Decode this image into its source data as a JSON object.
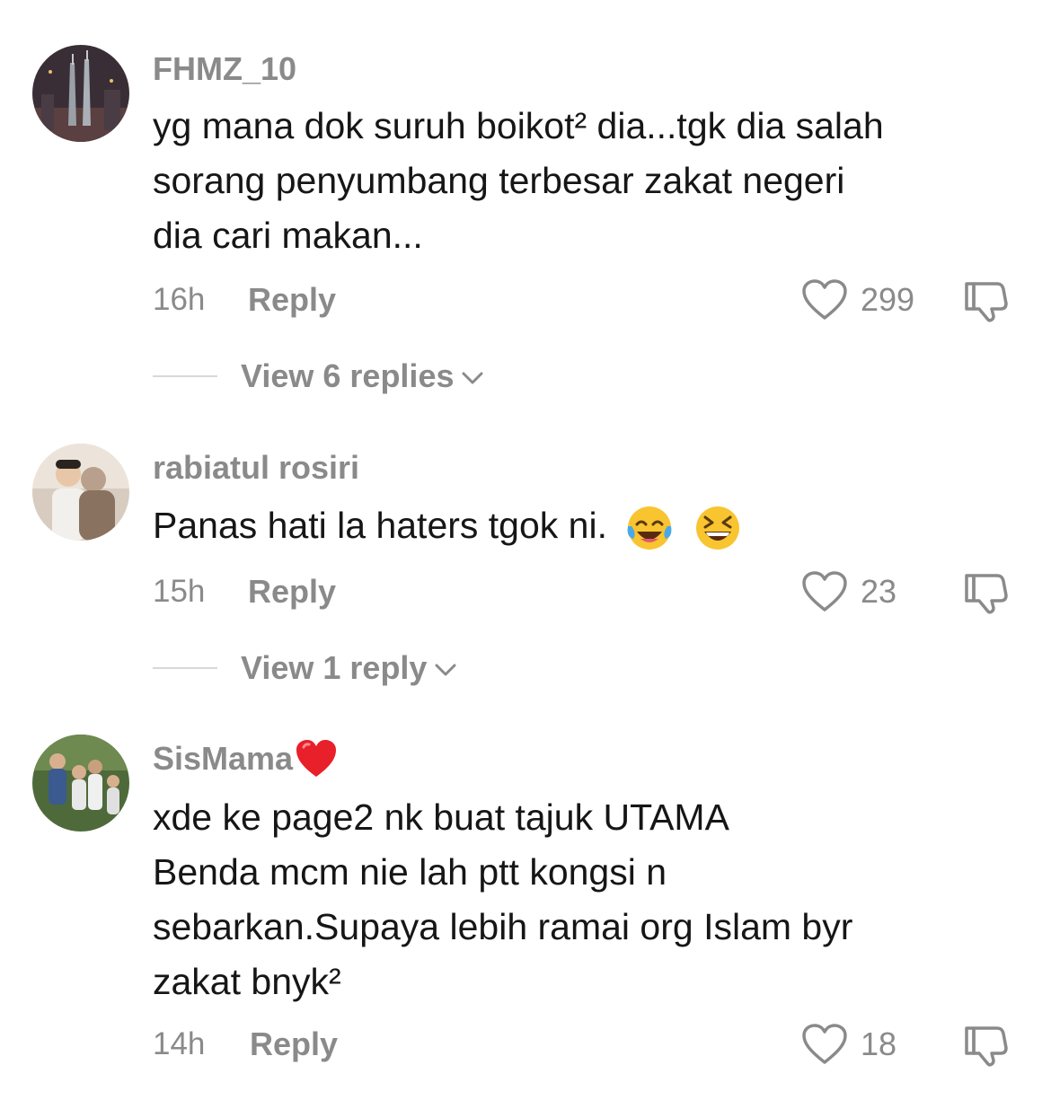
{
  "comments": [
    {
      "username": "FHMZ_10",
      "lines": [
        "yg mana dok suruh boikot² dia...tgk dia salah",
        "sorang penyumbang terbesar zakat negeri",
        "dia cari makan..."
      ],
      "time": "16h",
      "reply_label": "Reply",
      "likes": "299",
      "view_replies": "View 6 replies",
      "avatar_icon": "city-night-towers-avatar"
    },
    {
      "username": "rabiatul rosiri",
      "lines": [
        "Panas hati la haters tgok ni."
      ],
      "emojis": [
        "face-with-tears-of-joy",
        "grinning-squinting-face"
      ],
      "time": "15h",
      "reply_label": "Reply",
      "likes": "23",
      "view_replies": "View 1 reply",
      "avatar_icon": "couple-photo-avatar"
    },
    {
      "username": "SisMama",
      "username_emoji": "red-heart",
      "lines": [
        "xde ke page2 nk buat tajuk UTAMA",
        "Benda mcm nie lah ptt kongsi n",
        "sebarkan.Supaya lebih ramai org Islam byr",
        "zakat bnyk²"
      ],
      "time": "14h",
      "reply_label": "Reply",
      "likes": "18",
      "avatar_icon": "family-photo-avatar"
    }
  ],
  "colors": {
    "text": "#161616",
    "muted": "#8a8a8a",
    "divider": "#d8d8d8",
    "heart_emoji": "#e8202a"
  }
}
